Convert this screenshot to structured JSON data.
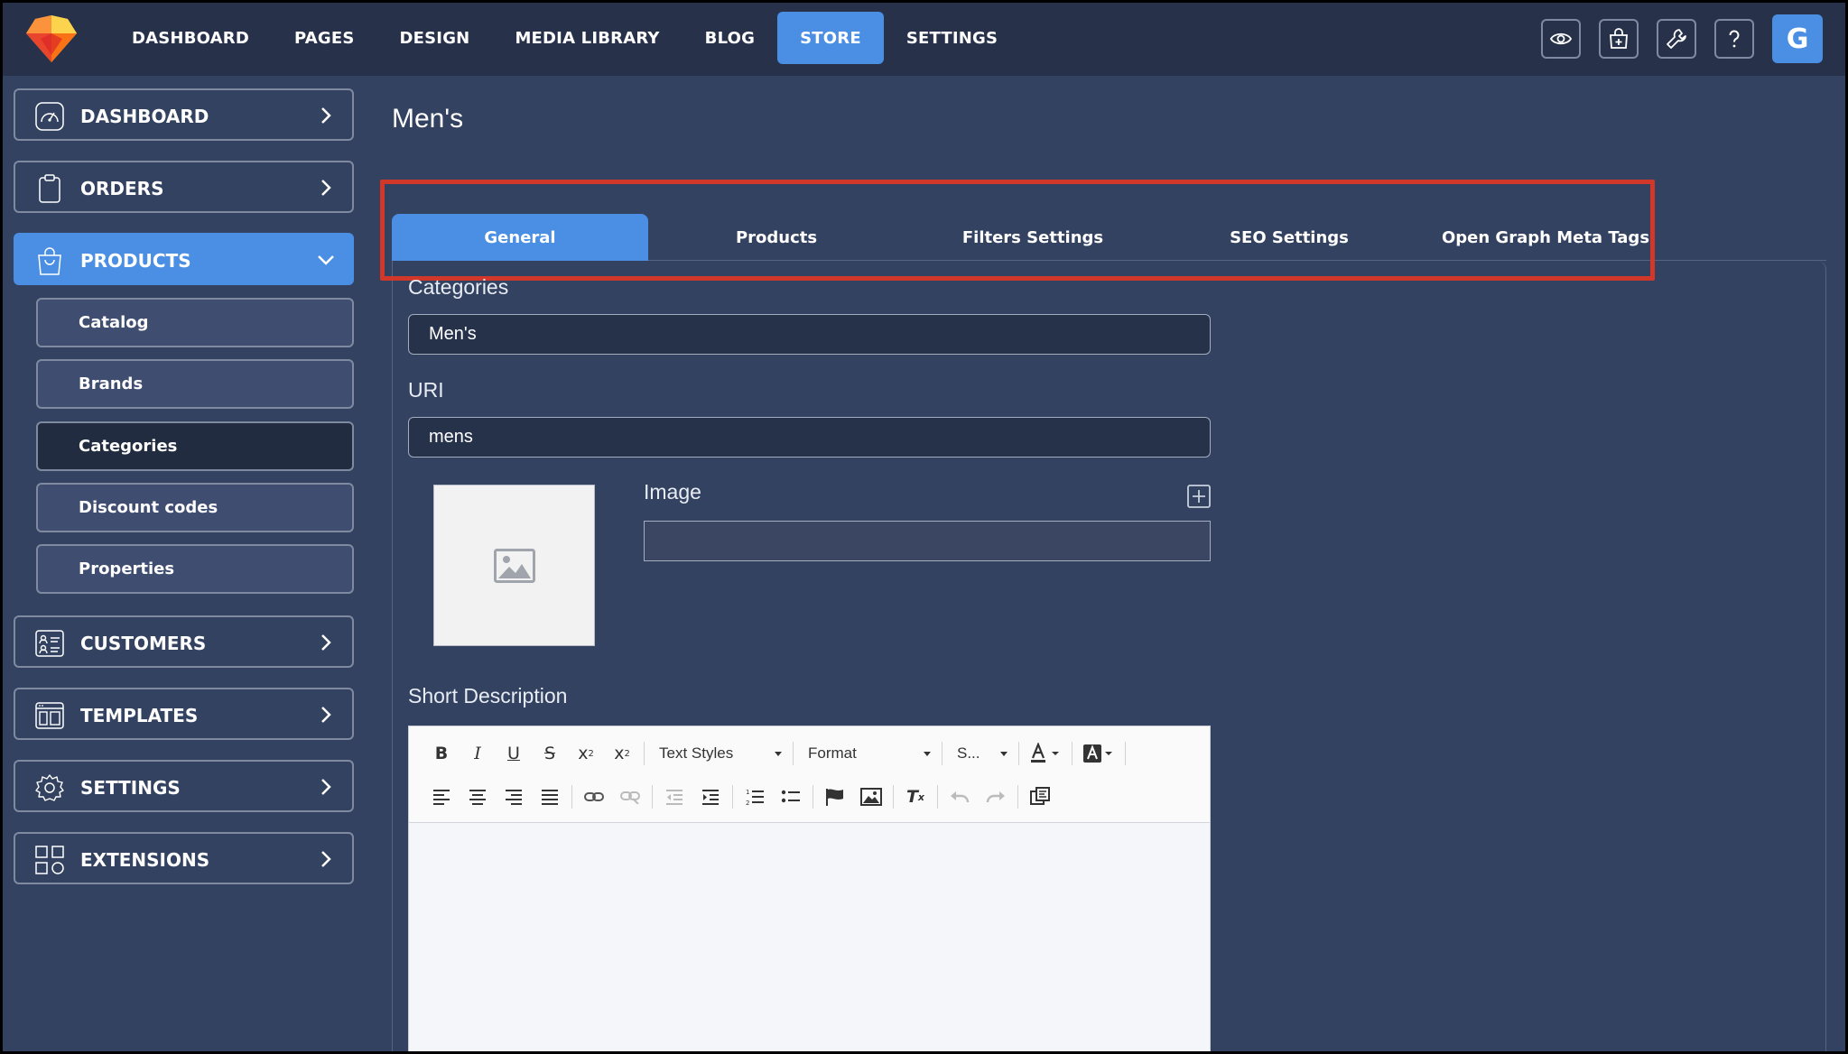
{
  "topnav": {
    "items": [
      "DASHBOARD",
      "PAGES",
      "DESIGN",
      "MEDIA LIBRARY",
      "BLOG",
      "STORE",
      "SETTINGS"
    ],
    "active": "STORE",
    "avatar_letter": "G",
    "icons": [
      "eye-icon",
      "shop-add-icon",
      "wrench-icon",
      "help-icon"
    ]
  },
  "sidebar": {
    "dashboard": "DASHBOARD",
    "orders": "ORDERS",
    "products": "PRODUCTS",
    "products_sub": [
      "Catalog",
      "Brands",
      "Categories",
      "Discount codes",
      "Properties"
    ],
    "current_sub": "Categories",
    "customers": "CUSTOMERS",
    "templates": "TEMPLATES",
    "settings": "SETTINGS",
    "extensions": "EXTENSIONS"
  },
  "page": {
    "title": "Men's",
    "tabs": [
      "General",
      "Products",
      "Filters Settings",
      "SEO Settings",
      "Open Graph Meta Tags"
    ],
    "active_tab": "General"
  },
  "form": {
    "categories_label": "Categories",
    "categories_value": "Men's",
    "uri_label": "URI",
    "uri_value": "mens",
    "image_label": "Image",
    "image_value": "",
    "short_description_label": "Short Description"
  },
  "editor": {
    "text_styles": "Text Styles",
    "format": "Format",
    "size": "S..."
  },
  "colors": {
    "accent": "#4a8fe3",
    "background": "#334260",
    "topbar": "#27324a",
    "highlight": "#d2382a"
  }
}
